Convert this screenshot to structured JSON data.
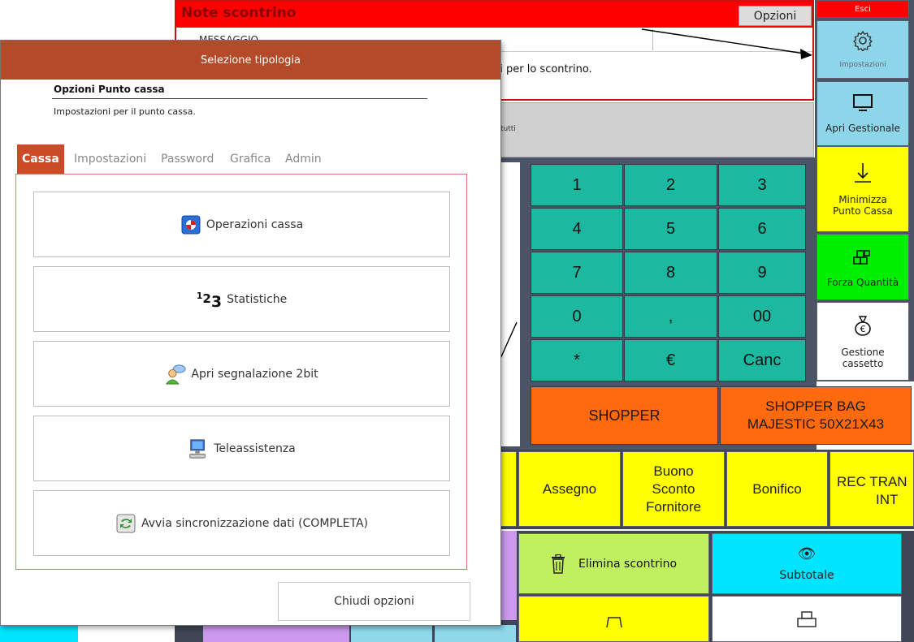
{
  "note": {
    "title": "Note scontrino",
    "options_label": "Opzioni",
    "column_header": "MESSAGGIO",
    "message": "gi per lo scontrino."
  },
  "gray_bar_text": "tutti",
  "keypad": {
    "keys": [
      "1",
      "2",
      "3",
      "4",
      "5",
      "6",
      "7",
      "8",
      "9",
      "0",
      ",",
      "00",
      "*",
      "€",
      "Canc"
    ]
  },
  "products": {
    "shopper": "SHOPPER",
    "shopper_bag_line1": "SHOPPER BAG",
    "shopper_bag_line2": "MAJESTIC 50X21X43"
  },
  "payments": {
    "assegno": "Assegno",
    "buono_line1": "Buono",
    "buono_line2": "Sconto",
    "buono_line3": "Fornitore",
    "bonifico": "Bonifico",
    "rec_line1": "REC TRAN",
    "rec_line2": "INT"
  },
  "bottom": {
    "elimina": "Elimina scontrino",
    "subtotale": "Subtotale"
  },
  "right_menu": {
    "esci": "Esci",
    "impostazioni": "Impostazioni",
    "apri_gestionale": "Apri Gestionale",
    "minimizza_line1": "Minimizza",
    "minimizza_line2": "Punto Cassa",
    "forza_quantita": "Forza Quantità",
    "gestione_line1": "Gestione",
    "gestione_line2": "cassetto"
  },
  "dialog": {
    "title": "Selezione tipologia",
    "heading": "Opzioni Punto cassa",
    "subheading": "Impostazioni per il punto cassa.",
    "tabs": [
      "Cassa",
      "Impostazioni",
      "Password",
      "Grafica",
      "Admin"
    ],
    "active_tab": "Cassa",
    "operations": [
      {
        "label": "Operazioni cassa",
        "icon": "cash-register-icon"
      },
      {
        "label": "Statistiche",
        "icon": "numbers-123-icon",
        "icon_text": "123"
      },
      {
        "label": "Apri segnalazione 2bit",
        "icon": "user-chat-icon"
      },
      {
        "label": "Teleassistenza",
        "icon": "computer-icon"
      },
      {
        "label": "Avvia sincronizzazione dati (COMPLETA)",
        "icon": "sync-icon"
      }
    ],
    "close_label": "Chiudi opzioni"
  },
  "colors": {
    "dialog_titlebar": "#b44b28",
    "active_tab": "#cc4a25",
    "keypad_key": "#1db8a0",
    "shopper": "#ff6a0e",
    "payment": "#ffff00",
    "header_red": "#ff0000"
  }
}
